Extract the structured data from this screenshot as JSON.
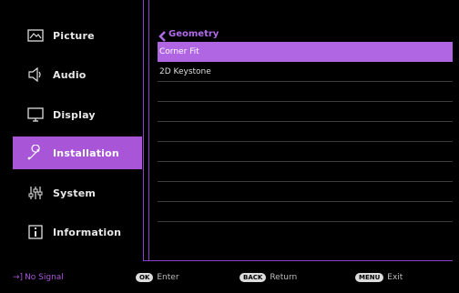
{
  "sidebar": {
    "items": [
      {
        "label": "Picture",
        "icon": "picture-icon",
        "active": false
      },
      {
        "label": "Audio",
        "icon": "speaker-icon",
        "active": false
      },
      {
        "label": "Display",
        "icon": "monitor-icon",
        "active": false
      },
      {
        "label": "Installation",
        "icon": "wrench-icon",
        "active": true
      },
      {
        "label": "System",
        "icon": "sliders-icon",
        "active": false
      },
      {
        "label": "Information",
        "icon": "info-icon",
        "active": false
      }
    ]
  },
  "panel": {
    "title": "Geometry",
    "options": [
      {
        "label": "Corner Fit",
        "selected": true
      },
      {
        "label": "2D Keystone",
        "selected": false
      },
      {
        "label": ""
      },
      {
        "label": ""
      },
      {
        "label": ""
      },
      {
        "label": ""
      },
      {
        "label": ""
      },
      {
        "label": ""
      },
      {
        "label": ""
      },
      {
        "label": ""
      }
    ]
  },
  "footer": {
    "status": "No Signal",
    "ok_key": "OK",
    "ok_label": "Enter",
    "back_key": "BACK",
    "back_label": "Return",
    "menu_key": "MENU",
    "menu_label": "Exit"
  },
  "colors": {
    "accent": "#a855d8",
    "background": "#000000"
  }
}
